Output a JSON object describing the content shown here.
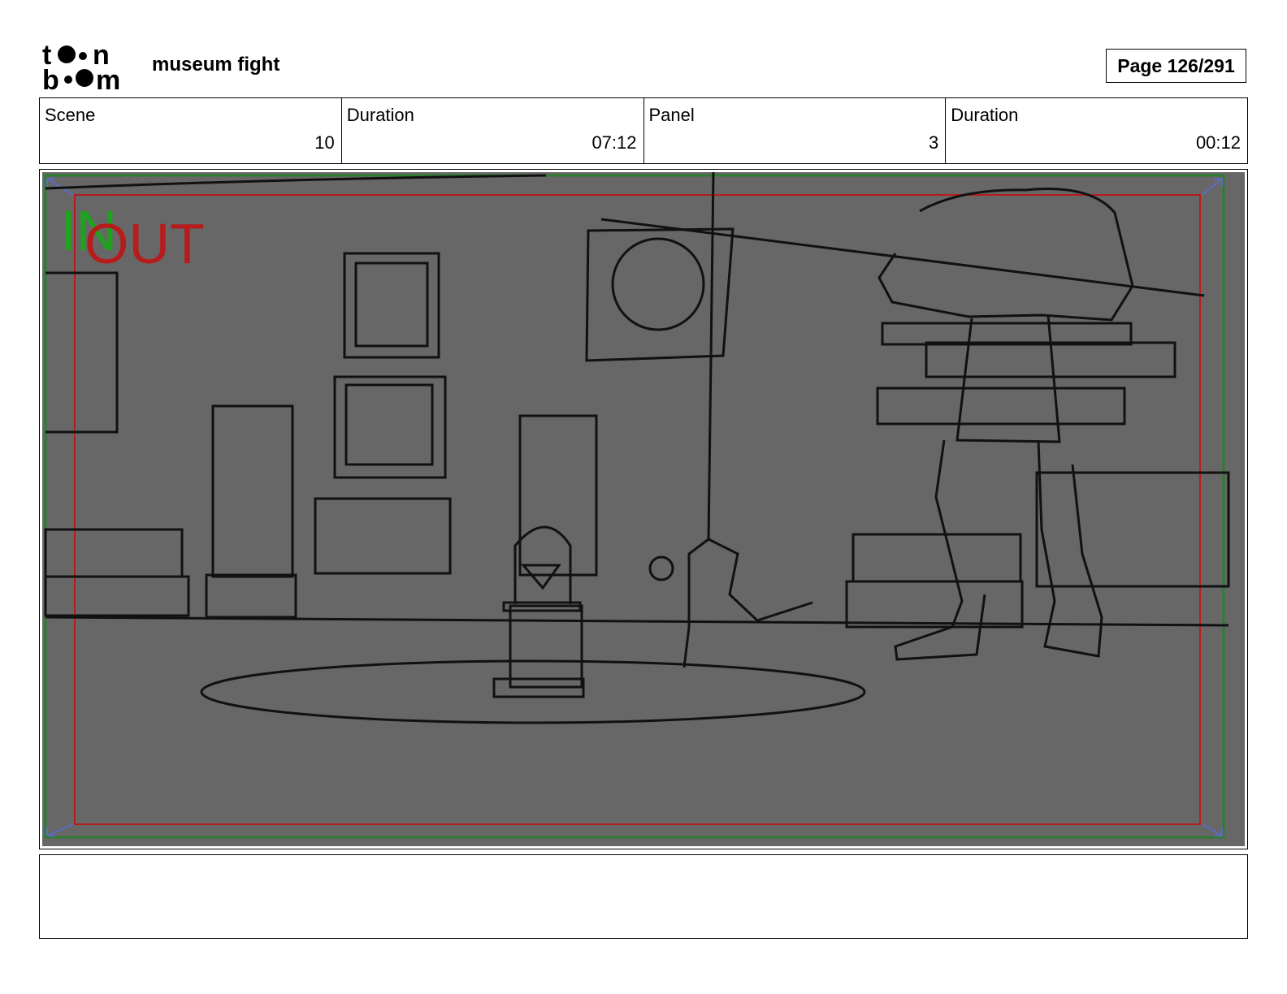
{
  "header": {
    "logo_text": "toon boom",
    "project_title": "museum fight",
    "page_label": "Page 126/291"
  },
  "info": [
    {
      "label": "Scene",
      "value": "10"
    },
    {
      "label": "Duration",
      "value": "07:12"
    },
    {
      "label": "Panel",
      "value": "3"
    },
    {
      "label": "Duration",
      "value": "00:12"
    }
  ],
  "panel": {
    "in_label": "IN",
    "out_label": "OUT",
    "background_color": "#676767",
    "safe_frame_color": "#2e7d32",
    "out_frame_color": "#b71c1c",
    "in_color": "#1fa31f"
  },
  "notes": {
    "text": ""
  }
}
